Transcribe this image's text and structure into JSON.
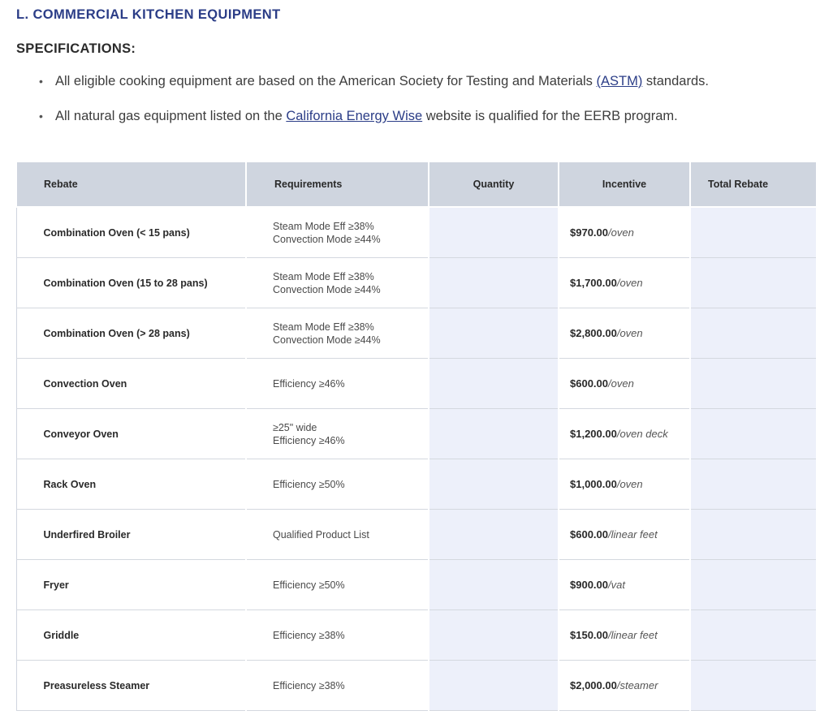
{
  "section_title": "L. COMMERCIAL KITCHEN EQUIPMENT",
  "specifications": {
    "heading": "SPECIFICATIONS:",
    "items": [
      {
        "before": "All eligible cooking equipment are based on the American Society for Testing and Materials ",
        "link": "(ASTM)",
        "after": " standards."
      },
      {
        "before": "All natural gas equipment listed on the ",
        "link": "California Energy Wise",
        "after": " website is qualified for the EERB program."
      }
    ]
  },
  "table": {
    "headers": [
      "Rebate",
      "Requirements",
      "Quantity",
      "Incentive",
      "Total Rebate"
    ],
    "rows": [
      {
        "rebate": "Combination Oven (< 15 pans)",
        "req1": "Steam Mode Eff ≥38%",
        "req2": "Convection Mode ≥44%",
        "amount": "$970.00",
        "unit": "/oven"
      },
      {
        "rebate": "Combination Oven (15 to 28 pans)",
        "req1": "Steam Mode Eff ≥38%",
        "req2": "Convection Mode ≥44%",
        "amount": "$1,700.00",
        "unit": "/oven"
      },
      {
        "rebate": "Combination Oven (> 28 pans)",
        "req1": "Steam Mode Eff ≥38%",
        "req2": "Convection Mode ≥44%",
        "amount": "$2,800.00",
        "unit": "/oven"
      },
      {
        "rebate": "Convection Oven",
        "req1": "Efficiency ≥46%",
        "req2": "",
        "amount": "$600.00",
        "unit": "/oven"
      },
      {
        "rebate": "Conveyor Oven",
        "req1": "≥25\" wide",
        "req2": "Efficiency ≥46%",
        "amount": "$1,200.00",
        "unit": "/oven deck"
      },
      {
        "rebate": "Rack Oven",
        "req1": "Efficiency ≥50%",
        "req2": "",
        "amount": "$1,000.00",
        "unit": "/oven"
      },
      {
        "rebate": "Underfired Broiler",
        "req1": "Qualified Product List",
        "req2": "",
        "amount": "$600.00",
        "unit": "/linear feet"
      },
      {
        "rebate": "Fryer",
        "req1": "Efficiency ≥50%",
        "req2": "",
        "amount": "$900.00",
        "unit": "/vat"
      },
      {
        "rebate": "Griddle",
        "req1": "Efficiency ≥38%",
        "req2": "",
        "amount": "$150.00",
        "unit": "/linear feet"
      },
      {
        "rebate": "Preasureless Steamer",
        "req1": "Efficiency ≥38%",
        "req2": "",
        "amount": "$2,000.00",
        "unit": "/steamer"
      }
    ]
  }
}
